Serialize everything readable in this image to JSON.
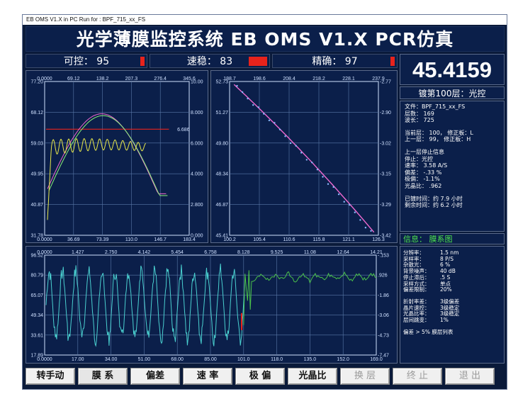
{
  "window_title": "EB OMS V1.X in PC Run for : BPF_715_xx_FS",
  "banner": "光学薄膜监控系统 EB OMS V1.X  PCR仿真",
  "status": [
    {
      "label": "可控： 95"
    },
    {
      "label": "速稳： 83"
    },
    {
      "label": "精确： 97"
    }
  ],
  "big_value": "45.4159",
  "layer_label": "镀第100层：光控",
  "info": {
    "file": "文件：BPF_715_xx_FS",
    "layers": "层数： 169",
    "wavelength": "波长： 725",
    "current": "当前层： 100，  修正板：L",
    "previous": "上一层： 99，  修正板：H",
    "stop_title": "上一层停止信息",
    "stop": "停止：光控",
    "rate": "速率： 3.58 A/S",
    "deviation": "偏差： -.33 %",
    "extreme": "极偏： -1.1%",
    "crystal": "光晶比： .962",
    "elapsed": "已镀时间：约 7.9 小时",
    "remaining": "剩余时间：约 6.2 小时"
  },
  "message": "信息：  膜系图",
  "params": [
    {
      "k": "分辨率：",
      "v": "1.5 nm"
    },
    {
      "k": "采样率：",
      "v": "8 P/S"
    },
    {
      "k": "杂散光：",
      "v": "6 %"
    },
    {
      "k": "背景噪声：",
      "v": "40 dB"
    },
    {
      "k": "停止滞后：",
      "v": ".5 S"
    },
    {
      "k": "采样方式：",
      "v": "单点"
    },
    {
      "k": "偏差限制：",
      "v": "20%"
    }
  ],
  "params2": [
    {
      "k": "折射率差：",
      "v": "3级偏差"
    },
    {
      "k": "晶片速控：",
      "v": "3级稳定"
    },
    {
      "k": "光晶比率：",
      "v": "3级稳定"
    },
    {
      "k": "层间跳变：",
      "v": "1%"
    }
  ],
  "params_note": "偏差 > 5% 膜层列表",
  "buttons": [
    {
      "label": "转手动",
      "enabled": true
    },
    {
      "label": "膜 系",
      "enabled": true
    },
    {
      "label": "偏差",
      "enabled": true
    },
    {
      "label": "速 率",
      "enabled": true
    },
    {
      "label": "极 偏",
      "enabled": true
    },
    {
      "label": "光晶比",
      "enabled": true
    },
    {
      "label": "换 层",
      "enabled": false
    },
    {
      "label": "终 止",
      "enabled": false
    },
    {
      "label": "退 出",
      "enabled": false
    }
  ],
  "chart_data": [
    {
      "type": "line",
      "id": "monitor-curve",
      "x_top": [
        "0.0000",
        "69.12",
        "138.2",
        "207.3",
        "276.4",
        "345.6"
      ],
      "x_bottom": [
        "0.0000",
        "36.69",
        "73.39",
        "110.0",
        "146.7",
        "183.4"
      ],
      "y_left": [
        "77.20",
        "68.12",
        "59.03",
        "49.95",
        "40.87",
        "31.78"
      ],
      "y_right": [
        "10.00",
        "8.000",
        "6.000",
        "4.000",
        "2.800",
        "0.000"
      ],
      "annotation": "6.686",
      "colors": {
        "target": "#e8231c",
        "measured": "#e8e84a",
        "sim1": "#f06ad0",
        "sim2": "#8af07a"
      }
    },
    {
      "type": "scatter",
      "id": "rate-curve",
      "x_top": [
        "188.7",
        "198.6",
        "208.4",
        "218.2",
        "228.1",
        "237.9"
      ],
      "x_bottom": [
        "100.2",
        "105.4",
        "110.6",
        "115.8",
        "121.1",
        "126.3"
      ],
      "y_left": [
        "52.73",
        "51.27",
        "49.80",
        "48.34",
        "46.87",
        "45.41"
      ],
      "y_right": [
        "-2.77",
        "-2.90",
        "-3.02",
        "-3.15",
        "-3.29",
        "-3.42"
      ],
      "colors": {
        "line": "#f06ad0",
        "points": "#8ab8ff"
      }
    },
    {
      "type": "line",
      "id": "spectrum-curve",
      "x_top": [
        "0.0000",
        "1.427",
        "2.750",
        "4.142",
        "5.454",
        "6.758",
        "8.128",
        "9.525",
        "11.08",
        "12.64",
        "14.21"
      ],
      "x_bottom": [
        "0.0000",
        "17.00",
        "34.00",
        "51.00",
        "68.00",
        "85.00",
        "101.0",
        "118.0",
        "135.0",
        "152.0",
        "169.0"
      ],
      "y_left": [
        "96.52",
        "80.79",
        "65.07",
        "49.34",
        "33.61",
        "17.89"
      ],
      "y_right": [
        "-.153",
        ".926",
        "-1.86",
        "-3.06",
        "-4.73",
        "-7.47"
      ],
      "colors": {
        "primary": "#4ad0d0",
        "secondary": "#4ac04a",
        "marker": "#e8231c"
      }
    }
  ]
}
